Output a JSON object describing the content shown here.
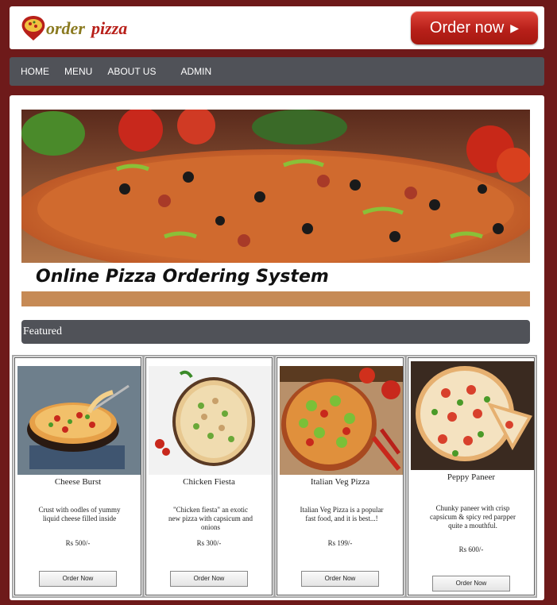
{
  "header": {
    "logo_text": "Orderpizza",
    "order_button_label": "Order now"
  },
  "nav": {
    "items": [
      {
        "label": "HOME"
      },
      {
        "label": "MENU"
      },
      {
        "label": "ABOUT US"
      },
      {
        "label": "ADMIN"
      }
    ]
  },
  "banner": {
    "caption": "Online Pizza Ordering System"
  },
  "featured": {
    "title": "Featured"
  },
  "products": [
    {
      "name": "Cheese Burst",
      "description": "Crust with oodles of yummy liquid cheese filled inside",
      "price": "Rs 500/-",
      "button": "Order Now"
    },
    {
      "name": "Chicken Fiesta",
      "description": "\"Chicken fiesta\" an exotic new pizza with capsicum and onions",
      "price": "Rs 300/-",
      "button": "Order Now"
    },
    {
      "name": "Italian Veg Pizza",
      "description": "Italian Veg Pizza is a popular fast food, and it is best...!",
      "price": "Rs 199/-",
      "button": "Order Now"
    },
    {
      "name": "Peppy Paneer",
      "description": "Chunky paneer with crisp capsicum & spicy red parpper quite a mouthful.",
      "price": "Rs 600/-",
      "button": "Order Now"
    }
  ],
  "colors": {
    "background": "#6e1a1a",
    "nav": "#505258",
    "order_button": "#c62a20"
  }
}
